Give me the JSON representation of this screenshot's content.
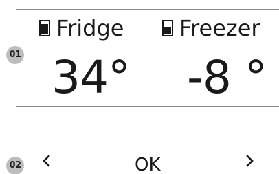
{
  "callouts": {
    "display": "01",
    "controls": "02"
  },
  "zones": {
    "fridge": {
      "label": "Fridge",
      "icon": "fridge-compartment-icon",
      "temperature": "34°"
    },
    "freezer": {
      "label": "Freezer",
      "icon": "freezer-compartment-icon",
      "temperature": "-8 °"
    }
  },
  "controls": {
    "prev_icon": "chevron-left-icon",
    "ok_label": "OK",
    "next_icon": "chevron-right-icon"
  },
  "colors": {
    "text": "#1a1a1a",
    "callout_bg": "#bdbdbd",
    "border": "#8a8a8a"
  }
}
